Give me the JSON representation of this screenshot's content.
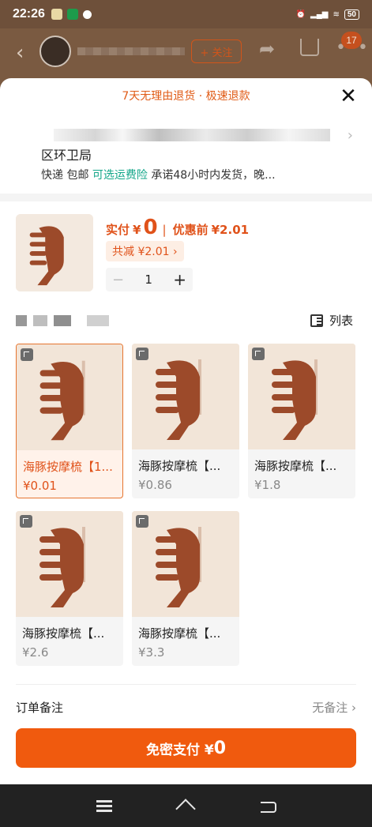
{
  "status_bar": {
    "time": "22:26",
    "battery": "50"
  },
  "background_header": {
    "follow_label": "+ 关注",
    "cart_badge": "17"
  },
  "sheet": {
    "promo": "7天无理由退货 · 极速退款",
    "close_icon": "close-icon",
    "address_region": "区环卫局",
    "shipping": {
      "method": "快递 包邮",
      "insurance": "可选运费险",
      "promise": "承诺48小时内发货，晚..."
    },
    "product": {
      "price_label": "实付",
      "currency": "¥",
      "price_value": "0",
      "before_label": "优惠前",
      "before_value": "¥2.01",
      "discount": "共减 ¥2.01 ›",
      "quantity": "1"
    },
    "variants": {
      "toggle_label": "列表",
      "items": [
        {
          "name": "海豚按摩梳【1...",
          "price": "¥0.01",
          "selected": true
        },
        {
          "name": "海豚按摩梳【...",
          "price": "¥0.86",
          "selected": false
        },
        {
          "name": "海豚按摩梳【...",
          "price": "¥1.8",
          "selected": false
        },
        {
          "name": "海豚按摩梳【...",
          "price": "¥2.6",
          "selected": false
        },
        {
          "name": "海豚按摩梳【...",
          "price": "¥3.3",
          "selected": false
        }
      ]
    },
    "remark": {
      "label": "订单备注",
      "value": "无备注 ›"
    },
    "pay_button": {
      "label": "免密支付 ¥",
      "amount": "0"
    }
  },
  "colors": {
    "accent": "#f05a0e",
    "teal": "#13a689",
    "dim_bg": "#7a5a41"
  }
}
